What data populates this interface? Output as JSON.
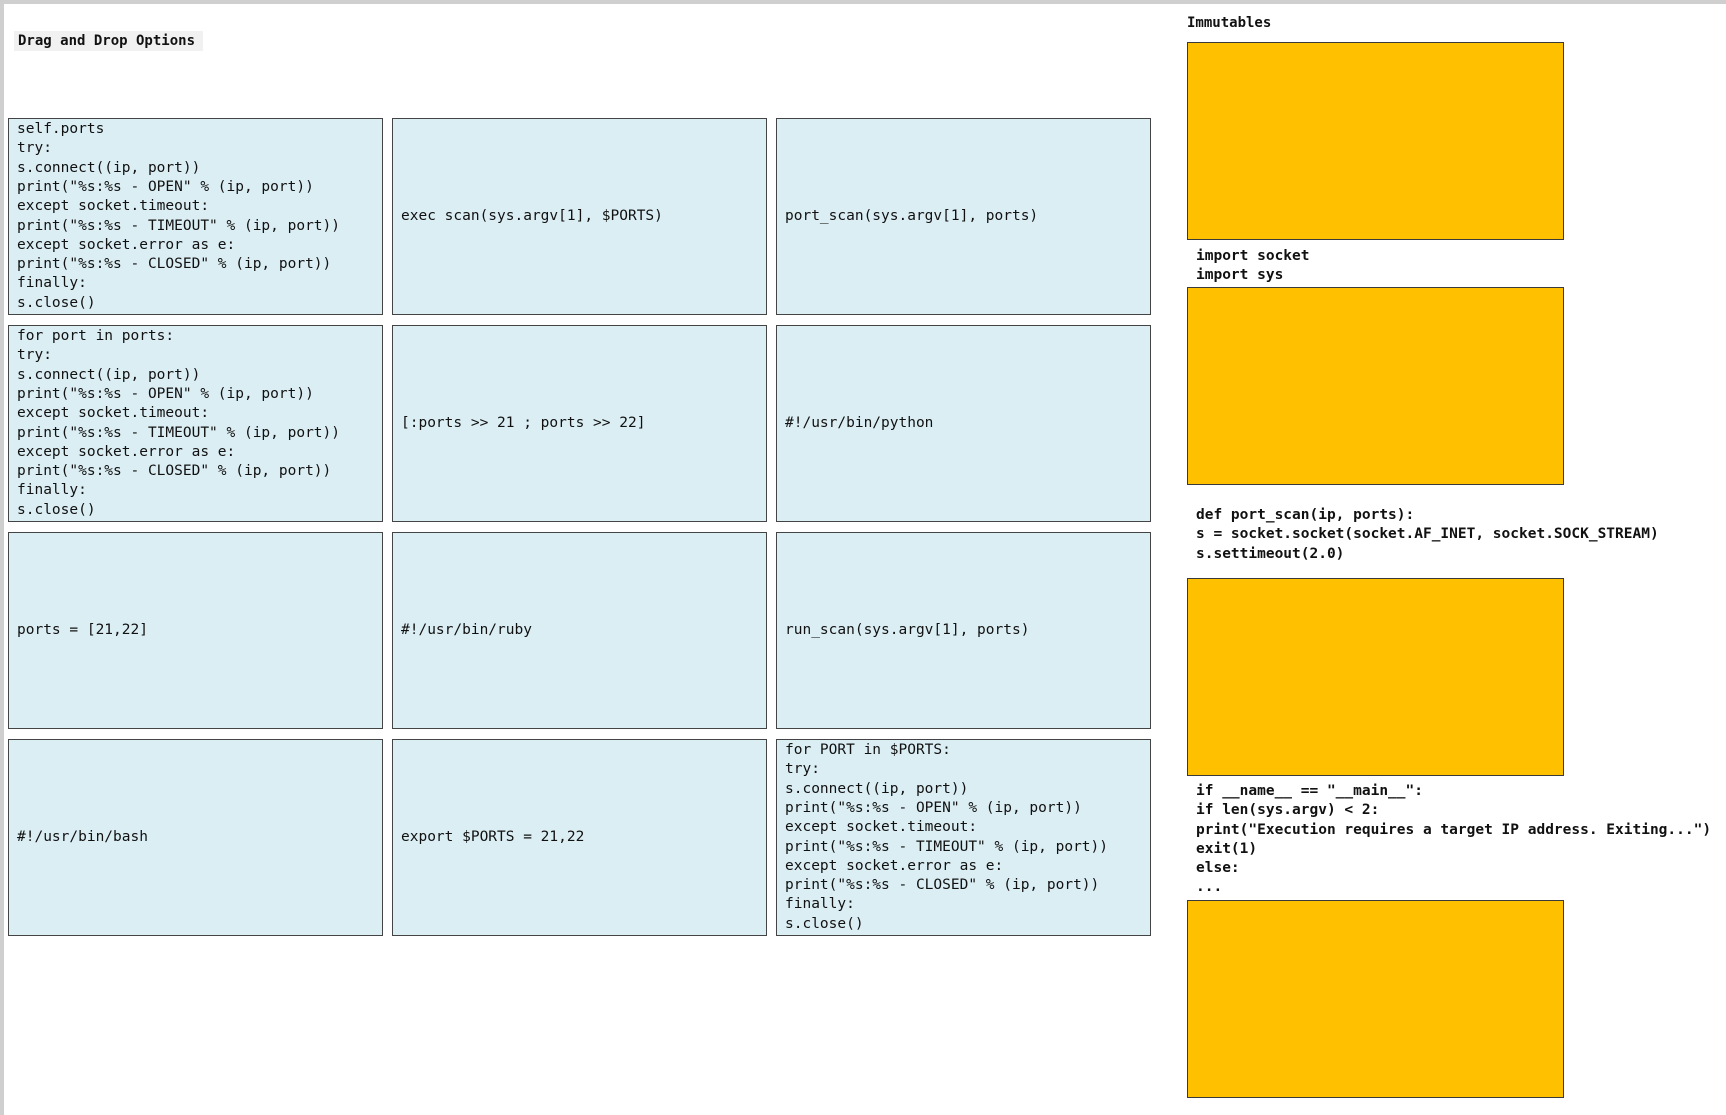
{
  "drag_and_drop": {
    "title": "Drag and Drop Options",
    "options": [
      {
        "lines": [
          "self.ports",
          "try:",
          "s.connect((ip, port))",
          "print(\"%s:%s - OPEN\" % (ip, port))",
          "except socket.timeout:",
          "print(\"%s:%s - TIMEOUT\" % (ip, port))",
          "except socket.error as e:",
          "print(\"%s:%s - CLOSED\" % (ip, port))",
          "finally:",
          "s.close()"
        ]
      },
      {
        "lines": [
          "exec scan(sys.argv[1], $PORTS)"
        ]
      },
      {
        "lines": [
          "port_scan(sys.argv[1], ports)"
        ]
      },
      {
        "lines": [
          "for port in ports:",
          "try:",
          "s.connect((ip, port))",
          "print(\"%s:%s - OPEN\" % (ip, port))",
          "except socket.timeout:",
          "print(\"%s:%s - TIMEOUT\" % (ip, port))",
          "except socket.error as e:",
          "print(\"%s:%s - CLOSED\" % (ip, port))",
          "finally:",
          "s.close()"
        ]
      },
      {
        "lines": [
          "[:ports >> 21 ; ports >> 22]"
        ]
      },
      {
        "lines": [
          "#!/usr/bin/python"
        ]
      },
      {
        "lines": [
          "ports = [21,22]"
        ]
      },
      {
        "lines": [
          "#!/usr/bin/ruby"
        ]
      },
      {
        "lines": [
          "run_scan(sys.argv[1], ports)"
        ]
      },
      {
        "lines": [
          "#!/usr/bin/bash"
        ]
      },
      {
        "lines": [
          "export $PORTS = 21,22"
        ]
      },
      {
        "lines": [
          "for PORT in $PORTS:",
          "try:",
          "s.connect((ip, port))",
          "print(\"%s:%s - OPEN\" % (ip, port))",
          "except socket.timeout:",
          "print(\"%s:%s - TIMEOUT\" % (ip, port))",
          "except socket.error as e:",
          "print(\"%s:%s - CLOSED\" % (ip, port))",
          "finally:",
          "s.close()"
        ]
      }
    ]
  },
  "immutables": {
    "title": "Immutables",
    "slot_color": "#ffc000",
    "blocks": [
      {
        "lines": [
          "import socket",
          "import sys"
        ]
      },
      {
        "lines": [
          "def port_scan(ip, ports):",
          "s = socket.socket(socket.AF_INET, socket.SOCK_STREAM)",
          "s.settimeout(2.0)"
        ]
      },
      {
        "lines": [
          "if __name__ == \"__main__\":",
          "if len(sys.argv) < 2:",
          "print(\"Execution requires a target IP address. Exiting...\")",
          "exit(1)",
          "else:",
          "..."
        ]
      }
    ]
  }
}
